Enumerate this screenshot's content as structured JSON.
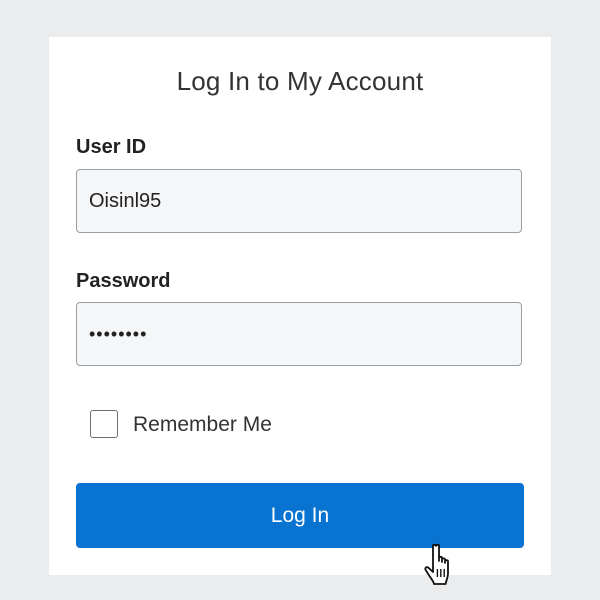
{
  "form": {
    "title": "Log In to My Account",
    "user_id_label": "User ID",
    "user_id_value": "Oisinl95",
    "password_label": "Password",
    "password_value": "••••••••",
    "remember_label": "Remember Me",
    "remember_checked": false,
    "login_button_label": "Log In"
  },
  "colors": {
    "background": "#ebecee",
    "card": "#ffffff",
    "button": "#0873d0",
    "input_bg": "#f5f6f8"
  },
  "icons": {
    "cursor": "hand-pointer-icon"
  }
}
